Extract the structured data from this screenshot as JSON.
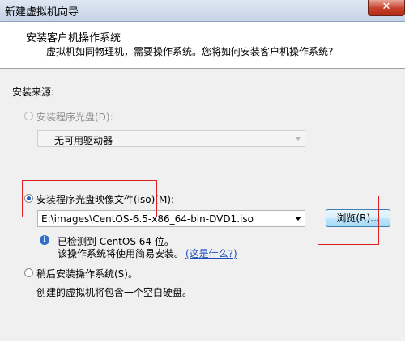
{
  "window": {
    "title": "新建虚拟机向导",
    "close_label": "✕"
  },
  "header": {
    "title": "安装客户机操作系统",
    "subtitle": "虚拟机如同物理机，需要操作系统。您将如何安装客户机操作系统?"
  },
  "install_source_label": "安装来源:",
  "option_disc": {
    "label": "安装程序光盘(D):",
    "enabled": false,
    "selected": false
  },
  "disc_drive": {
    "value": "无可用驱动器"
  },
  "option_iso": {
    "label": "安装程序光盘映像文件(iso)(M):",
    "selected": true
  },
  "iso_path": {
    "value": "E:\\images\\CentOS-6.5-x86_64-bin-DVD1.iso"
  },
  "browse_button": {
    "label": "浏览(R)..."
  },
  "detection": {
    "line1": "已检测到 CentOS 64 位。",
    "line2": "该操作系统将使用简易安装。",
    "link": "(这是什么?)"
  },
  "option_later": {
    "label": "稍后安装操作系统(S)。",
    "selected": false
  },
  "later_note": "创建的虚拟机将包含一个空白硬盘。",
  "colors": {
    "highlight_box": "#e02020",
    "link": "#1c4fbd",
    "header_bg": "#ffffff"
  }
}
